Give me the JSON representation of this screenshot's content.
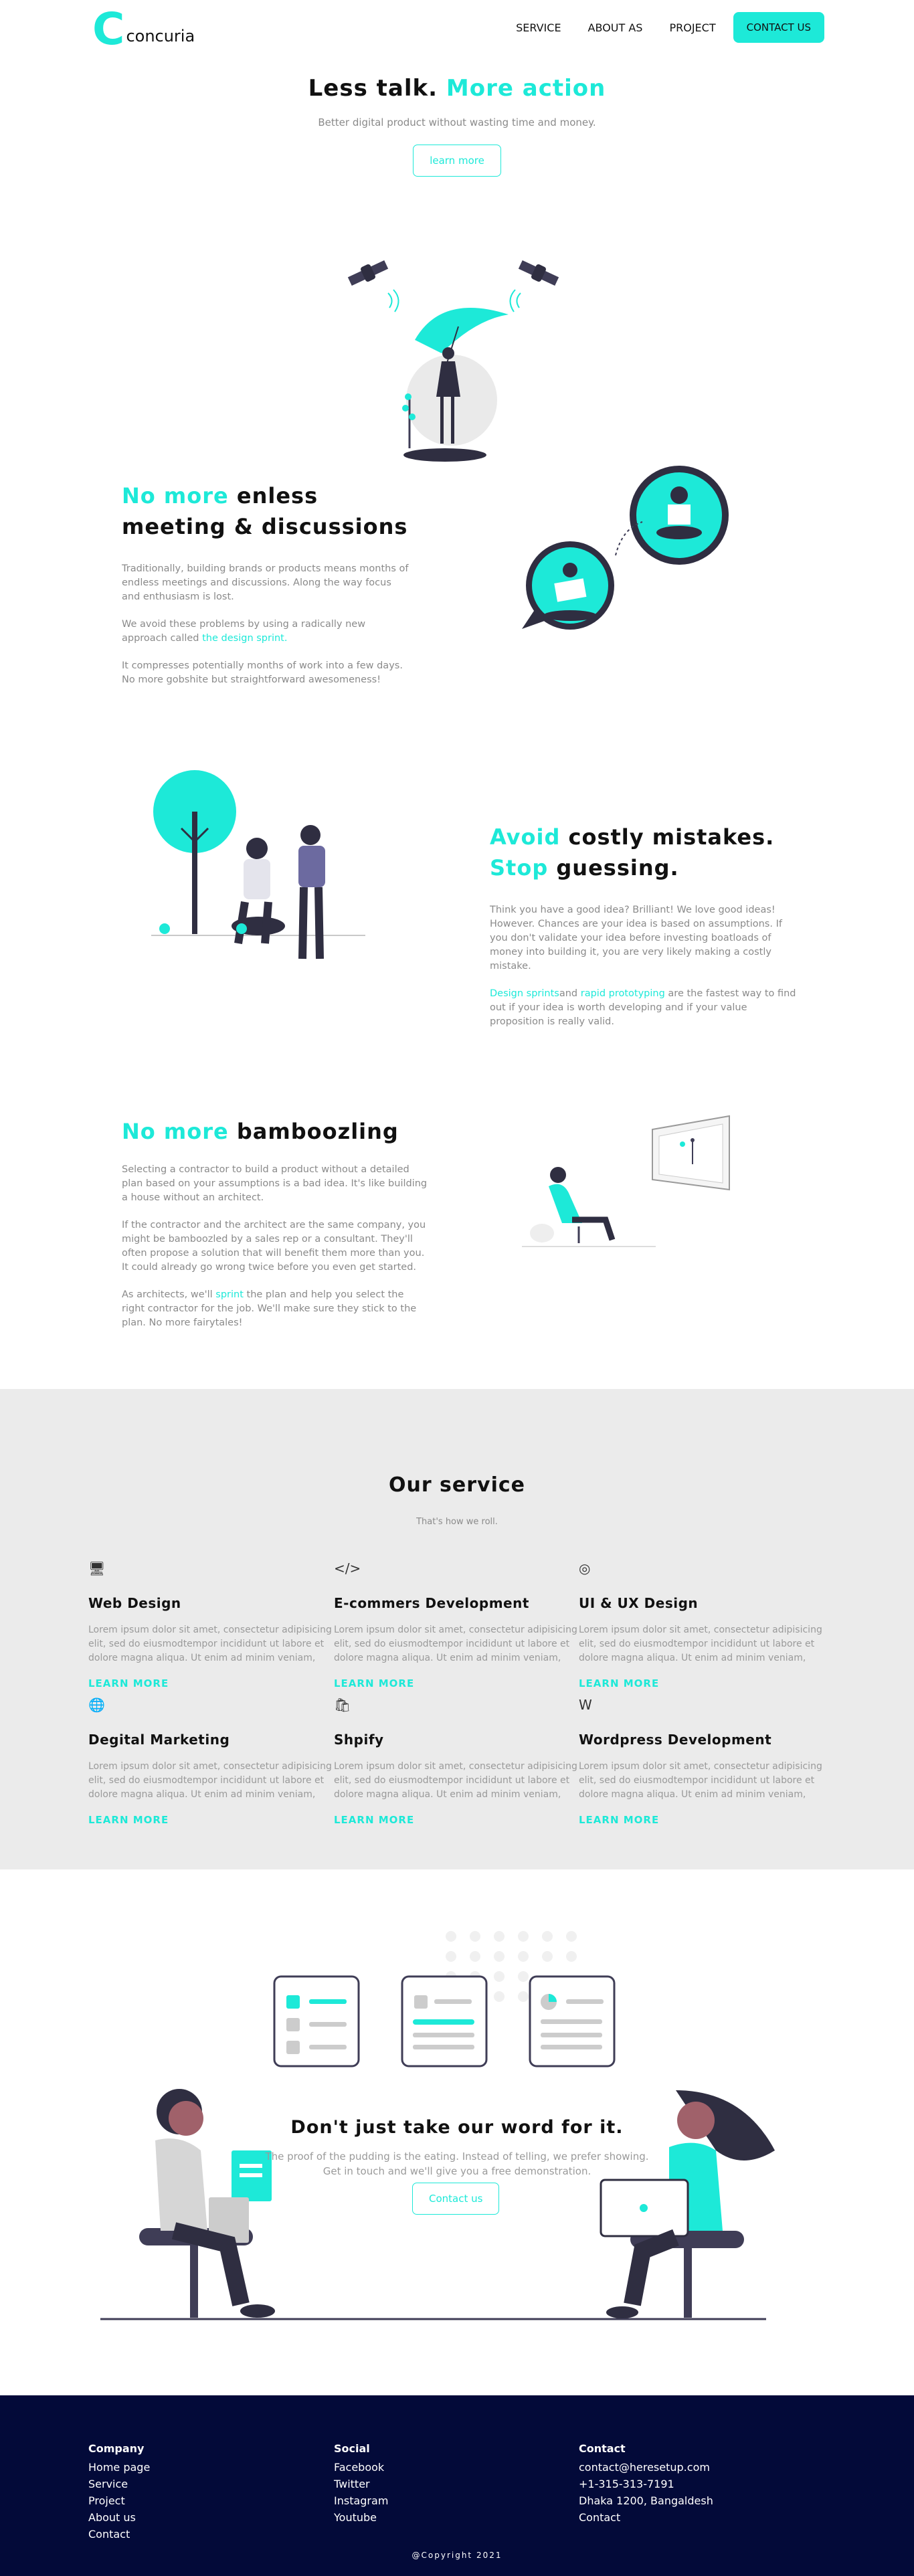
{
  "header": {
    "logo_letter": "C",
    "logo_text": "concuria",
    "nav": [
      "SERVICE",
      "ABOUT AS",
      "PROJECT"
    ],
    "cta": "CONTACT US"
  },
  "hero": {
    "title_a": "Less talk.",
    "title_b": "More action",
    "subtitle": "Better digital product without wasting time and money.",
    "button": "learn more"
  },
  "section1": {
    "title_a": "No more",
    "title_b": "enless",
    "title_c": "meeting & discussions",
    "p1": "Traditionally, building brands or products means months of endless meetings and discussions. Along the way focus and enthusiasm is lost.",
    "p2_a": "We avoid these problems by using a radically new approach called ",
    "p2_link": "the design sprint.",
    "p3": "It compresses potentially months of work into a few days. No more gobshite but straightforward awesomeness!"
  },
  "section2": {
    "title_a": "Avoid",
    "title_b": "costly mistakes.",
    "title_c": "Stop",
    "title_d": "guessing.",
    "p1": "Think you have a good idea? Brilliant! We love good ideas! However. Chances are your idea is based on assumptions. If you don't validate your idea before investing boatloads of money into building it, you are very likely making a costly mistake.",
    "link1": "Design sprints",
    "and": "and ",
    "link2": "rapid prototyping",
    "p2_rest": " are the fastest way to find out if your idea is worth developing and if your value proposition is really valid."
  },
  "section3": {
    "title_a": "No more",
    "title_b": "bamboozling",
    "p1": "Selecting a contractor to build a product without a detailed plan based on your assumptions is a bad idea. It's like building a house without an architect.",
    "p2": "If the contractor and the architect are the same company, you might be bamboozled by a sales rep or a consultant. They'll often propose a solution that will benefit them more than you. It could already go wrong twice before you even get started.",
    "p3_a": "As architects, we'll ",
    "p3_link": "sprint",
    "p3_b": " the plan and help you select the right contractor for the job. We'll make sure they stick to the plan. No more fairytales!"
  },
  "services": {
    "title": "Our service",
    "subtitle": "That's how we roll.",
    "items": [
      {
        "icon": "monitor-icon",
        "glyph": "🖥",
        "title": "Web Design",
        "text": "Lorem ipsum dolor sit amet, consectetur adipisicing elit, sed do eiusmodtempor incididunt ut labore et dolore magna aliqua. Ut enim ad minim veniam,",
        "more": "LEARN MORE"
      },
      {
        "icon": "code-icon",
        "glyph": "</>",
        "title": "E-commers Development",
        "text": "Lorem ipsum dolor sit amet, consectetur adipisicing elit, sed do eiusmodtempor incididunt ut labore et dolore magna aliqua. Ut enim ad minim veniam,",
        "more": "LEARN MORE"
      },
      {
        "icon": "design-icon",
        "glyph": "◎",
        "title": "UI & UX Design",
        "text": "Lorem ipsum dolor sit amet, consectetur adipisicing elit, sed do eiusmodtempor incididunt ut labore et dolore magna aliqua. Ut enim ad minim veniam,",
        "more": "LEARN MORE"
      },
      {
        "icon": "globe-icon",
        "glyph": "🌐",
        "title": "Degital Marketing",
        "text": "Lorem ipsum dolor sit amet, consectetur adipisicing elit, sed do eiusmodtempor incididunt ut labore et dolore magna aliqua. Ut enim ad minim veniam,",
        "more": "LEARN MORE"
      },
      {
        "icon": "shopify-icon",
        "glyph": "🛍",
        "title": "Shpify",
        "text": "Lorem ipsum dolor sit amet, consectetur adipisicing elit, sed do eiusmodtempor incididunt ut labore et dolore magna aliqua. Ut enim ad minim veniam,",
        "more": "LEARN MORE"
      },
      {
        "icon": "wordpress-icon",
        "glyph": "W",
        "title": "Wordpress Development",
        "text": "Lorem ipsum dolor sit amet, consectetur adipisicing elit, sed do eiusmodtempor incididunt ut labore et dolore magna aliqua. Ut enim ad minim veniam,",
        "more": "LEARN MORE"
      }
    ]
  },
  "testimonial": {
    "title": "Don't just take our word for it.",
    "line1": "The proof of the pudding is the eating. Instead of telling, we prefer showing.",
    "line2": "Get in touch and we'll give you a free demonstration.",
    "button": "Contact us"
  },
  "footer": {
    "company": {
      "title": "Company",
      "items": [
        "Home page",
        "Service",
        "Project",
        "About us",
        "Contact"
      ]
    },
    "social": {
      "title": "Social",
      "items": [
        "Facebook",
        "Twitter",
        "Instagram",
        "Youtube"
      ]
    },
    "contact": {
      "title": "Contact",
      "items": [
        "contact@heresetup.com",
        "+1-315-313-7191",
        "Dhaka 1200, Bangaldesh",
        "Contact"
      ]
    },
    "copyright": "@Copyright 2021"
  },
  "colors": {
    "accent": "#1de9d8",
    "footer_bg": "#030a39",
    "services_bg": "#ebebeb"
  }
}
